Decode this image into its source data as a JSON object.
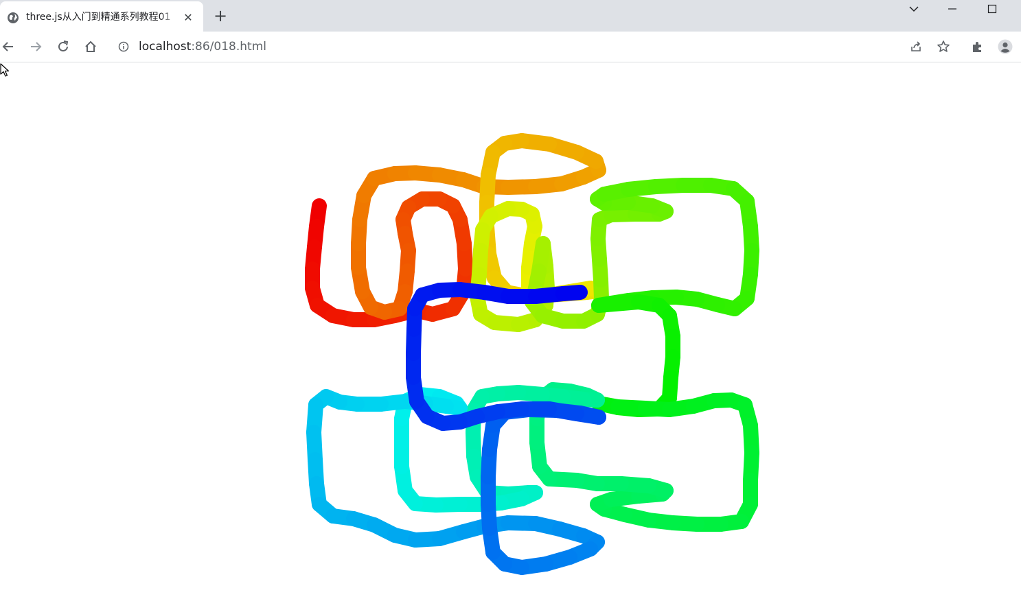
{
  "browser": {
    "tab": {
      "title": "three.js从入门到精通系列教程01",
      "favicon": "globe-icon",
      "close_icon": "close-icon"
    },
    "new_tab_icon": "plus-icon",
    "window_controls": [
      "chevron-down-icon",
      "minimize-icon",
      "maximize-icon"
    ],
    "nav": {
      "back_icon": "arrow-left-icon",
      "forward_icon": "arrow-right-icon",
      "reload_icon": "reload-icon",
      "home_icon": "home-icon"
    },
    "address": {
      "host": "localhost",
      "rest": ":86/018.html",
      "info_icon": "info-icon"
    },
    "toolbar_icons": [
      "share-icon",
      "star-icon",
      "extensions-icon",
      "profile-icon"
    ]
  },
  "scene": {
    "description_icon": "rainbow-tube-curve",
    "background": "#ffffff"
  }
}
